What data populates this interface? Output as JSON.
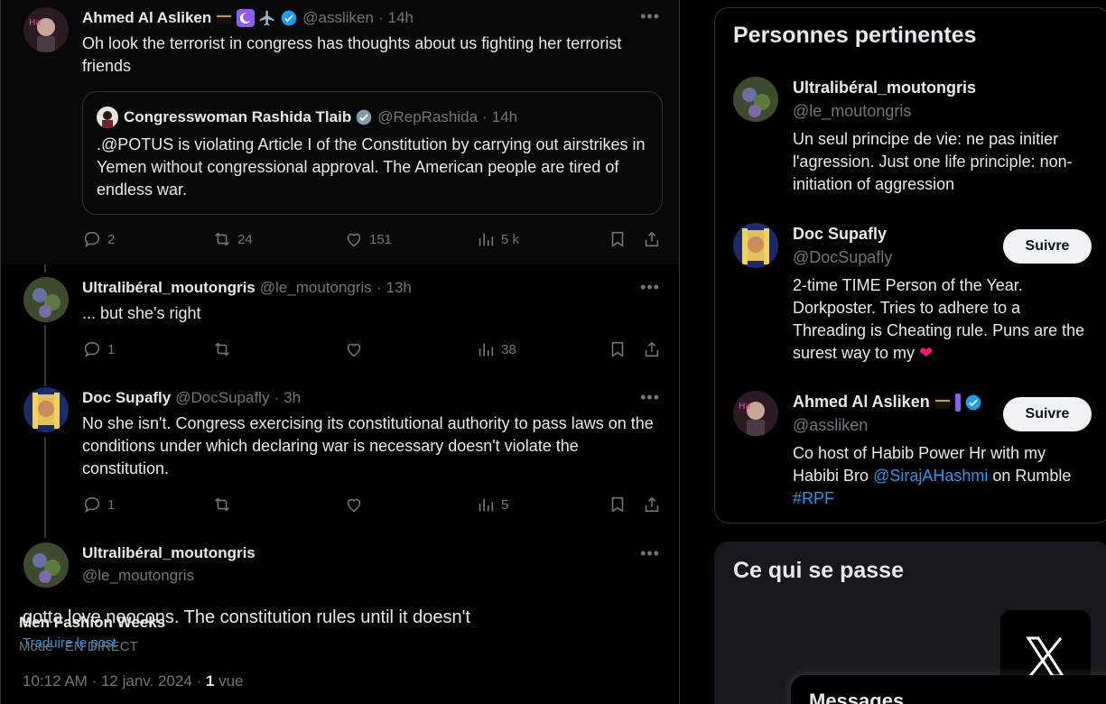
{
  "thread": [
    {
      "name": "Ahmed Al Asliken",
      "handle": "@assliken",
      "time": "14h",
      "text": "Oh look the terrorist in congress has thoughts about us fighting her terrorist friends",
      "quote": {
        "name": "Congresswoman Rashida Tlaib",
        "handle": "@RepRashida",
        "time": "14h",
        "text": ".@POTUS is violating Article I of the Constitution by carrying out airstrikes in Yemen without congressional approval. The American people are tired of endless war."
      },
      "replies": "2",
      "reposts": "24",
      "likes": "151",
      "views": "5 k"
    },
    {
      "name": "Ultralibéral_moutongris",
      "handle": "@le_moutongris",
      "time": "13h",
      "text": "... but she's right",
      "replies": "1",
      "reposts": "",
      "likes": "",
      "views": "38"
    },
    {
      "name": "Doc Supafly",
      "handle": "@DocSupafly",
      "time": "3h",
      "text": "No she isn't. Congress exercising its constitutional authority to pass laws on the conditions under which declaring war is necessary doesn't violate the constitution.",
      "replies": "1",
      "reposts": "",
      "likes": "",
      "views": "5"
    }
  ],
  "main_post": {
    "name": "Ultralibéral_moutongris",
    "handle": "@le_moutongris",
    "text": "gotta love neocons. The constitution rules until it doesn't",
    "translate": "Traduire le post",
    "time": "10:12 AM",
    "date": "12 janv. 2024",
    "views_count": "1",
    "views_label": "vue"
  },
  "relevant": {
    "title": "Personnes pertinentes",
    "people": [
      {
        "name": "Ultralibéral_moutongris",
        "handle": "@le_moutongris",
        "bio": "Un seul principe de vie: ne pas initier l'agression. Just one life principle: non-initiation of aggression"
      },
      {
        "name": "Doc Supafly",
        "handle": "@DocSupafly",
        "bio": "2-time TIME Person of the Year. Dorkposter. Tries to adhere to a Threading is Cheating rule. Puns are the surest way to my",
        "follow": "Suivre"
      },
      {
        "name": "Ahmed Al Asliken",
        "handle": "@assliken",
        "bio_before": "Co host of Habib Power Hr with my Habibi Bro",
        "bio_link": "@SirajAHashmi",
        "bio_after": "on Rumble",
        "bio_tag": "#RPF",
        "follow": "Suivre"
      }
    ]
  },
  "trends": {
    "title": "Ce qui se passe",
    "item_name": "Men Fashion Weeks",
    "item_category": "Mode",
    "item_status": "EN DIRECT"
  },
  "messages": {
    "title": "Messages"
  },
  "colors": {
    "accent": "#1d9bf0",
    "muted": "#71767b",
    "text": "#e7e9ea",
    "border": "#2f3336",
    "like_red": "#f91880"
  }
}
